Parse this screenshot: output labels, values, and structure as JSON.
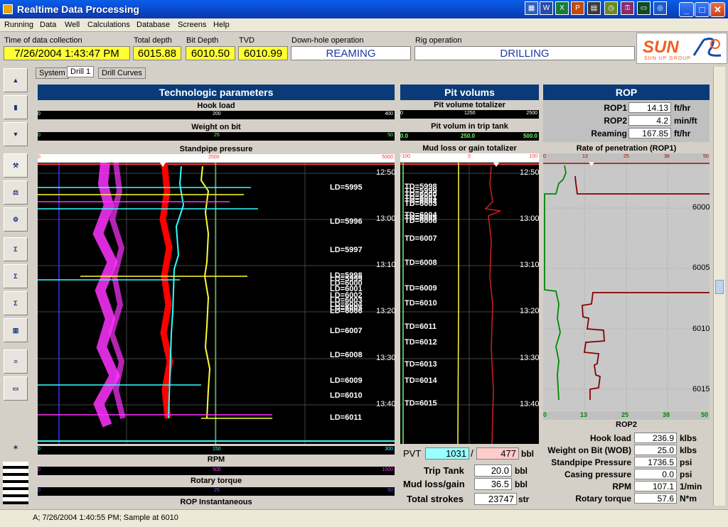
{
  "window": {
    "title": "Realtime Data Processing"
  },
  "menu": [
    "Running",
    "Data",
    "Well",
    "Calculations",
    "Database",
    "Screens",
    "Help"
  ],
  "info": {
    "time_label": "Time of data collection",
    "time_value": "7/26/2004 1:43:47 PM",
    "total_depth_label": "Total depth",
    "total_depth_value": "6015.88",
    "bit_depth_label": "Bit Depth",
    "bit_depth_value": "6010.50",
    "tvd_label": "TVD",
    "tvd_value": "6010.99",
    "downhole_label": "Down-hole operation",
    "downhole_value": "REAMING",
    "rig_label": "Rig operation",
    "rig_value": "DRILLING"
  },
  "logo": {
    "text": "SUN",
    "subtitle": "SUN UP GROUP"
  },
  "tabs": [
    "System",
    "Drill 1",
    "Drill Curves"
  ],
  "tech": {
    "title": "Technologic parameters",
    "hook_load": "Hook load",
    "hook_scale": [
      "0",
      "200",
      "400"
    ],
    "wob": "Weight on bit",
    "wob_scale": [
      "0",
      "25",
      "50"
    ],
    "spp": "Standpipe pressure",
    "spp_scale": [
      "0",
      "2500",
      "5000"
    ],
    "rpm": "RPM",
    "rpm_scale": [
      "0",
      "150",
      "300"
    ],
    "torque": "Rotary torque",
    "torque_scale": [
      "0",
      "500",
      "1000"
    ],
    "torque_scale2": [
      "0",
      "25",
      "50"
    ],
    "rop_inst": "ROP Instantaneous",
    "times": [
      "12:50",
      "13:00",
      "13:10",
      "13:20",
      "13:30",
      "13:40"
    ],
    "ld_labels": [
      "LD=5995",
      "LD=5996",
      "LD=5997",
      "LD=5998",
      "LD=5999",
      "LD=6000",
      "LD=6001",
      "LD=6002",
      "LD=6003",
      "LD=6004",
      "LD=6005",
      "LD=6006",
      "LD=6007",
      "LD=6008",
      "LD=6009",
      "LD=6010",
      "LD=6011"
    ]
  },
  "pit": {
    "title": "Pit volums",
    "pvt_label": "Pit volume totalizer",
    "pvt_scale": [
      "0",
      "1250",
      "2500"
    ],
    "trip_label": "Pit volum in trip tank",
    "trip_scale": [
      "0.0",
      "250.0",
      "500.0"
    ],
    "mud_label": "Mud loss or gain totalizer",
    "mud_scale": [
      "-100",
      "0",
      "100"
    ],
    "times": [
      "12:50",
      "13:00",
      "13:10",
      "13:20",
      "13:30",
      "13:40"
    ],
    "td_labels": [
      "TD=5998",
      "TD=5999",
      "TD=6000",
      "TD=6001",
      "TD=6002",
      "TD=6003",
      "TD=6004",
      "TD=6005",
      "TD=6006",
      "TD=6007",
      "TD=6008",
      "TD=6009",
      "TD=6010",
      "TD=6011",
      "TD=6012",
      "TD=6013",
      "TD=6014",
      "TD=6015"
    ],
    "pvt_row_label": "PVT",
    "pvt_value1": "1031",
    "pvt_sep": "/",
    "pvt_value2": "477",
    "pvt_unit": "bbl",
    "trip_tank_label": "Trip Tank",
    "trip_tank_value": "20.0",
    "trip_tank_unit": "bbl",
    "mud_row_label": "Mud loss/gain",
    "mud_row_value": "36.5",
    "mud_row_unit": "bbl",
    "strokes_label": "Total strokes",
    "strokes_value": "23747",
    "strokes_unit": "str"
  },
  "rop": {
    "title": "ROP",
    "rop1_label": "ROP1",
    "rop1_value": "14.13",
    "rop1_unit": "ft/hr",
    "rop2_label": "ROP2",
    "rop2_value": "4.2",
    "rop2_unit": "min/ft",
    "reaming_label": "Reaming",
    "reaming_value": "167.85",
    "reaming_unit": "ft/hr",
    "chart_label": "Rate of penetration (ROP1)",
    "top_scale": [
      "0",
      "13",
      "25",
      "38",
      "50"
    ],
    "bottom_scale": [
      "0",
      "13",
      "25",
      "38",
      "50"
    ],
    "depths": [
      "6000",
      "6005",
      "6010",
      "6015"
    ],
    "rop2_axis": "ROP2",
    "readouts": [
      {
        "label": "Hook load",
        "value": "236.9",
        "unit": "klbs"
      },
      {
        "label": "Weight on Bit (WOB)",
        "value": "25.0",
        "unit": "klbs"
      },
      {
        "label": "Standpipe Pressure",
        "value": "1736.5",
        "unit": "psi"
      },
      {
        "label": "Casing pressure",
        "value": "0.0",
        "unit": "psi"
      },
      {
        "label": "RPM",
        "value": "107.1",
        "unit": "1/min"
      },
      {
        "label": "Rotary torque",
        "value": "57.6",
        "unit": "N*m"
      }
    ]
  },
  "status": "A; 7/26/2004 1:40:55 PM; Sample at 6010",
  "colors": {
    "header_blue": "#0a3a78",
    "info_yellow": "#ffff33",
    "pvt_cyan": "#99ffff",
    "pvt_pink": "#ffcccc"
  }
}
